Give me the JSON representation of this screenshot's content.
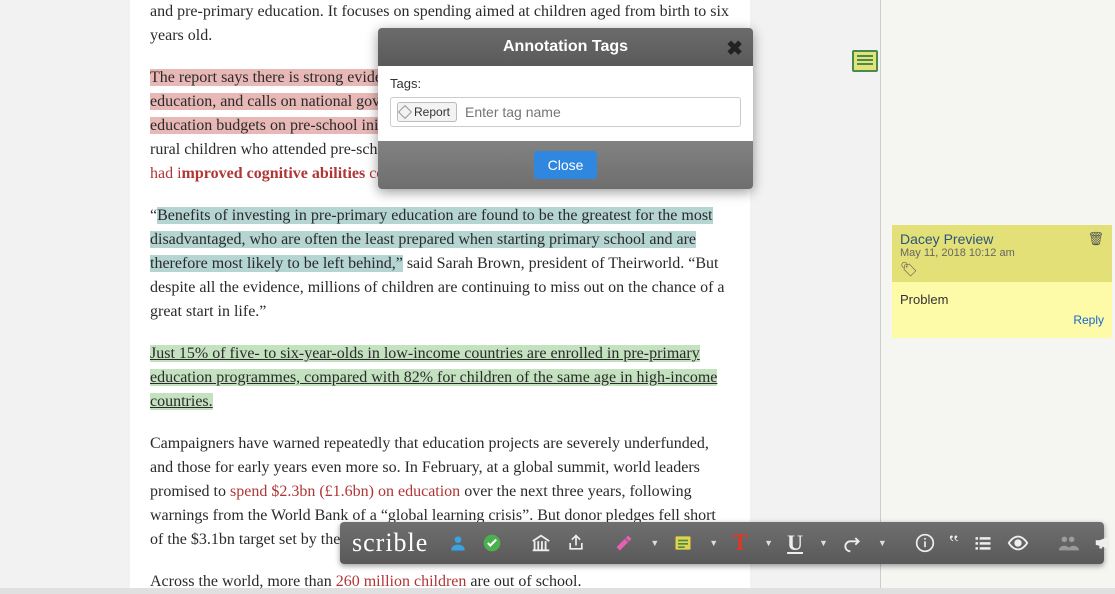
{
  "article": {
    "p1": "and pre-primary education. It focuses on spending aimed at children aged from birth to six years old.",
    "p2_hl": "The report says there is strong evidence of the benefits of investing in pre-school education, and calls on national governments to invest a minimum of 10% of their education budgets on pre-school initiatives.",
    "p2_rest": " It cites a study in Mozambique which found rural children who attended pre-school were more likely to enrol in primary school and ",
    "p2_red_pre": "had i",
    "p2_red_bold": "mproved cognitive abilities",
    "p2_red_post": " compared with their peers who had not enrolled.",
    "p3_quote_open": "“",
    "p3_hl": "Benefits of investing in pre-primary education are found to be the greatest for the most disadvantaged, who are often the least prepared when starting primary school and are therefore most likely to be left behind,”",
    "p3_rest": " said Sarah Brown, president of Theirworld. “But despite all the evidence, millions of children are continuing to miss out on the chance of a great start in life.”",
    "p4_ul": "Just 15% of five- to six-year-olds in low-income countries are enrolled in pre-primary education programmes, compared with 82% for children of the same age in high-income countries.",
    "p5_a": "Campaigners have warned repeatedly that education projects are severely underfunded, and those for early years even more so. In February, at a global summit, world leaders promised to ",
    "p5_link": "spend $2.3bn (£1.6bn) on education",
    "p5_b": " over the next three years, following warnings from the World Bank of a “global learning crisis”. But donor pledges fell short of the $3.1bn target set by the Global Partnership for Education.",
    "p6_a": "Across the world, more than ",
    "p6_link": "260 million children",
    "p6_b": " are out of school."
  },
  "modal": {
    "title": "Annotation Tags",
    "label": "Tags:",
    "chip": "Report",
    "placeholder": "Enter tag name",
    "close": "Close"
  },
  "note": {
    "author": "Dacey Preview",
    "date": "May 11, 2018 10:12 am",
    "body": "Problem",
    "reply": "Reply"
  },
  "toolbar": {
    "logo": "scrible",
    "T": "T",
    "U": "U"
  }
}
